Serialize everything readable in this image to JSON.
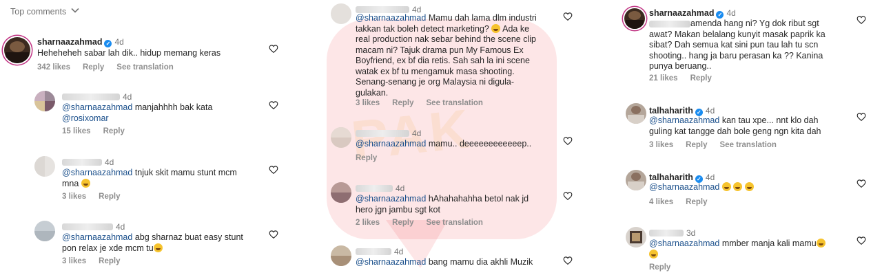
{
  "header": {
    "title": "Top comments"
  },
  "watermark": {
    "text": "PAK"
  },
  "col1": [
    {
      "user": "sharnaazahmad",
      "time": "4d",
      "text": "Heheheheh sabar lah dik.. hidup memang keras",
      "likes": "342 likes",
      "reply": "Reply",
      "translation": "See translation"
    },
    {
      "user": "",
      "time": "4d",
      "mention": "@sharnaazahmad",
      "text": " manjahhhh bak kata",
      "mention2": "@rosixomar",
      "likes": "15 likes",
      "reply": "Reply"
    },
    {
      "user": "",
      "time": "4d",
      "mention": "@sharnaazahmad",
      "text": " tnjuk skit mamu stunt mcm\nmna ",
      "likes": "3 likes",
      "reply": "Reply"
    },
    {
      "user": "",
      "time": "4d",
      "mention": "@sharnaazahmad",
      "text": " abg sharnaz buat easy stunt\npon relax je xde mcm tu",
      "likes": "3 likes",
      "reply": "Reply"
    }
  ],
  "col2": [
    {
      "user": "",
      "time": "4d",
      "mention": "@sharnaazahmad",
      "text": " Mamu dah lama dlm industri\ntakkan tak boleh detect marketing? ",
      "text2": " Ada ke\nreal production nak sebar behind the scene clip\nmacam ni? Tajuk drama pun My Famous Ex\nBoyfriend, ex bf dia retis. Sah sah la ini scene\nwatak ex bf tu mengamuk masa shooting.\nSenang-senang je org Malaysia ni digula-\ngulakan.",
      "likes": "3 likes",
      "reply": "Reply",
      "translation": "See translation"
    },
    {
      "user": "",
      "time": "4d",
      "mention": "@sharnaazahmad",
      "text": " mamu.. deeeeeeeeeeeep..",
      "reply": "Reply"
    },
    {
      "user": "",
      "time": "4d",
      "mention": "@sharnaazahmad",
      "text": " hAhahahahha betol nak jd\nhero jgn jambu sgt kot",
      "likes": "2 likes",
      "reply": "Reply",
      "translation": "See translation"
    },
    {
      "user": "",
      "time": "4d",
      "mention": "@sharnaazahmad",
      "text": " bang mamu dia akhli Muzik"
    }
  ],
  "col3": [
    {
      "user": "sharnaazahmad",
      "time": "4d",
      "text": "amenda hang ni? Yg dok ribut sgt\nawat? Makan belalang kunyit masak paprik ka\nsibat? Dah semua kat sini pun tau lah tu scn\nshooting.. hang ja baru perasan ka ?? Kanina\npunya beruang..",
      "likes": "21 likes",
      "reply": "Reply"
    },
    {
      "user": "talhaharith",
      "time": "4d",
      "mention": "@sharnaazahmad",
      "text": " kan tau xpe... nnt klo dah\nguling kat tangge dah bole geng ngn kita dah",
      "likes": "3 likes",
      "reply": "Reply",
      "translation": "See translation"
    },
    {
      "user": "talhaharith",
      "time": "4d",
      "mention": "@sharnaazahmad",
      "text": " ",
      "likes": "4 likes",
      "reply": "Reply"
    },
    {
      "user": "",
      "time": "3d",
      "mention": "@sharnaazahmad",
      "text": " mmber manja kali mamu",
      "reply": "Reply"
    }
  ],
  "colors": {
    "mention": "#1a4f8b",
    "meta": "#8e8e8e",
    "verified": "#1a8cf0"
  },
  "icons": {
    "heart": "heart-outline-icon",
    "chevron": "chevron-down-icon"
  }
}
